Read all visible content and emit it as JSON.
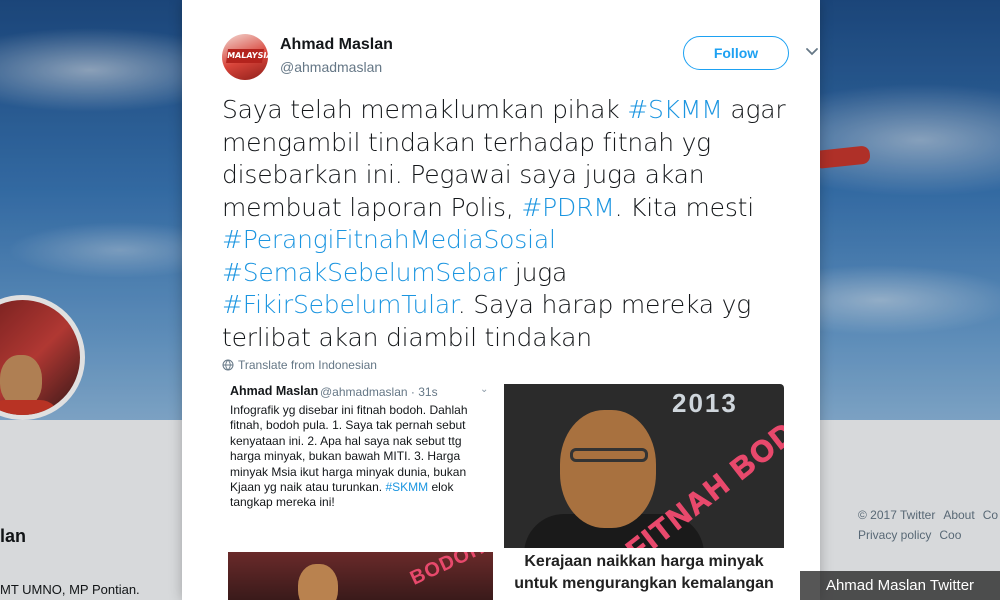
{
  "background": {
    "profile_name": "lan",
    "profile_bio": "MT UMNO, MP Pontian.",
    "footer": [
      "© 2017 Twitter",
      "About",
      "Co",
      "Privacy policy",
      "Coo"
    ]
  },
  "tweet": {
    "author_name": "Ahmad Maslan",
    "author_handle": "@ahmadmaslan",
    "avatar_text": "MALAYSIA",
    "follow_label": "Follow",
    "text_segments": [
      {
        "t": "Saya telah memaklumkan pihak ",
        "tag": false
      },
      {
        "t": "#SKMM",
        "tag": true
      },
      {
        "t": " agar mengambil tindakan terhadap fitnah yg disebarkan ini. Pegawai saya juga akan membuat laporan Polis, ",
        "tag": false
      },
      {
        "t": "#PDRM",
        "tag": true
      },
      {
        "t": ". Kita mesti ",
        "tag": false
      },
      {
        "t": "#PerangiFitnahMediaSosial",
        "tag": true
      },
      {
        "t": " ",
        "tag": false
      },
      {
        "t": "#SemakSebelumSebar",
        "tag": true
      },
      {
        "t": " juga ",
        "tag": false
      },
      {
        "t": "#FikirSebelumTular",
        "tag": true
      },
      {
        "t": ". Saya harap mereka yg terlibat akan diambil tindakan",
        "tag": false
      }
    ],
    "translate_label": "Translate from Indonesian"
  },
  "media": {
    "screenshot": {
      "name": "Ahmad Maslan",
      "handle": "@ahmadmaslan · 31s",
      "body_text": "Infografik yg disebar ini fitnah bodoh. Dahlah fitnah, bodoh pula. 1. Saya tak pernah sebut kenyataan ini. 2. Apa hal saya nak sebut ttg harga minyak, bukan bawah MITI. 3. Harga minyak Msia ikut harga minyak dunia, bukan Kjaan yg naik atau turunkan. ",
      "body_tag": "#SKMM",
      "body_tail": " elok tangkap mereka ini!",
      "photo_stamp": "BODOH"
    },
    "graphic": {
      "year": "2013",
      "stamp": "FITNAH BODOH",
      "caption_line1": "Kerajaan naikkan harga minyak",
      "caption_line2": "untuk mengurangkan kemalangan"
    }
  },
  "watermark": "Ahmad Maslan Twitter",
  "colors": {
    "link": "#1b95e0",
    "follow_border": "#1da1f2",
    "stamp": "#e8496c"
  }
}
